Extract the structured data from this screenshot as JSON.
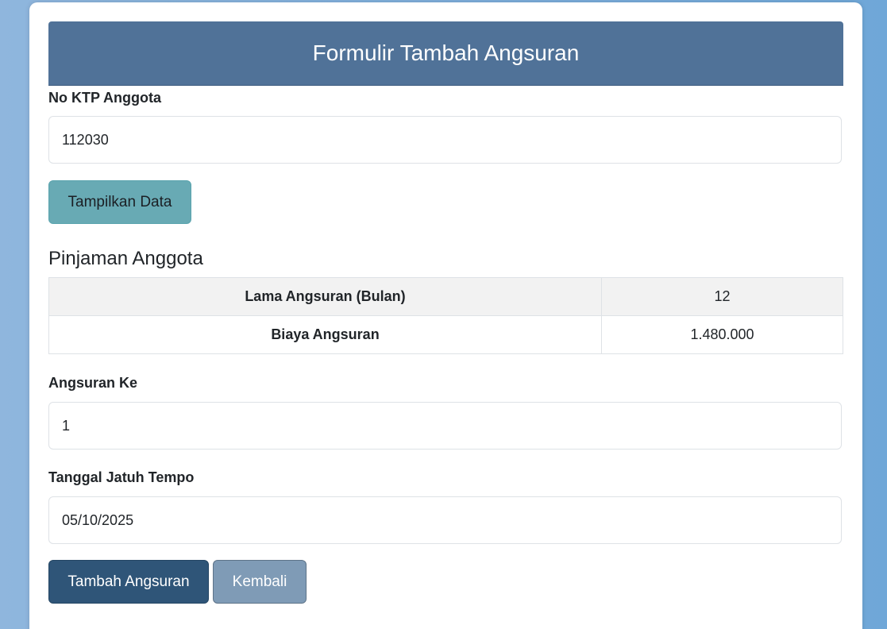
{
  "form": {
    "title": "Formulir Tambah Angsuran",
    "ktp": {
      "label": "No KTP Anggota",
      "value": "112030"
    },
    "show_button_label": "Tampilkan Data"
  },
  "loan": {
    "title": "Pinjaman Anggota",
    "rows": [
      {
        "key": "Lama Angsuran (Bulan)",
        "value": "12"
      },
      {
        "key": "Biaya Angsuran",
        "value": "1.480.000"
      }
    ]
  },
  "installment": {
    "label": "Angsuran Ke",
    "value": "1"
  },
  "due_date": {
    "label": "Tanggal Jatuh Tempo",
    "value": "05/10/2025"
  },
  "actions": {
    "add_label": "Tambah Angsuran",
    "back_label": "Kembali"
  },
  "colors": {
    "header": "#507298",
    "show_button": "#68aab4",
    "add_button": "#2f5578",
    "back_button": "#7f9bb6"
  }
}
